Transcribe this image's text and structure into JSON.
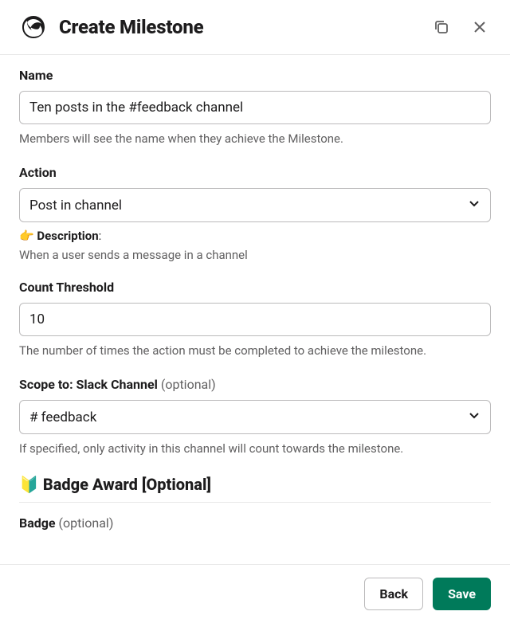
{
  "header": {
    "title": "Create Milestone"
  },
  "fields": {
    "name": {
      "label": "Name",
      "value": "Ten posts in the #feedback channel",
      "help": "Members will see the name when they achieve the Milestone."
    },
    "action": {
      "label": "Action",
      "value": "Post in channel",
      "desc_emoji": "👉",
      "desc_label": "Description",
      "desc_text": "When a user sends a message in a channel"
    },
    "threshold": {
      "label": "Count Threshold",
      "value": "10",
      "help": "The number of times the action must be completed to achieve the milestone."
    },
    "scope": {
      "label_main": "Scope to: Slack Channel",
      "label_optional": "(optional)",
      "value": "# feedback",
      "help": "If specified, only activity in this channel will count towards the milestone."
    },
    "badge_section": {
      "emoji": "🔰",
      "title": "Badge Award [Optional]"
    },
    "badge": {
      "label_main": "Badge",
      "label_optional": "(optional)"
    }
  },
  "footer": {
    "back": "Back",
    "save": "Save"
  }
}
